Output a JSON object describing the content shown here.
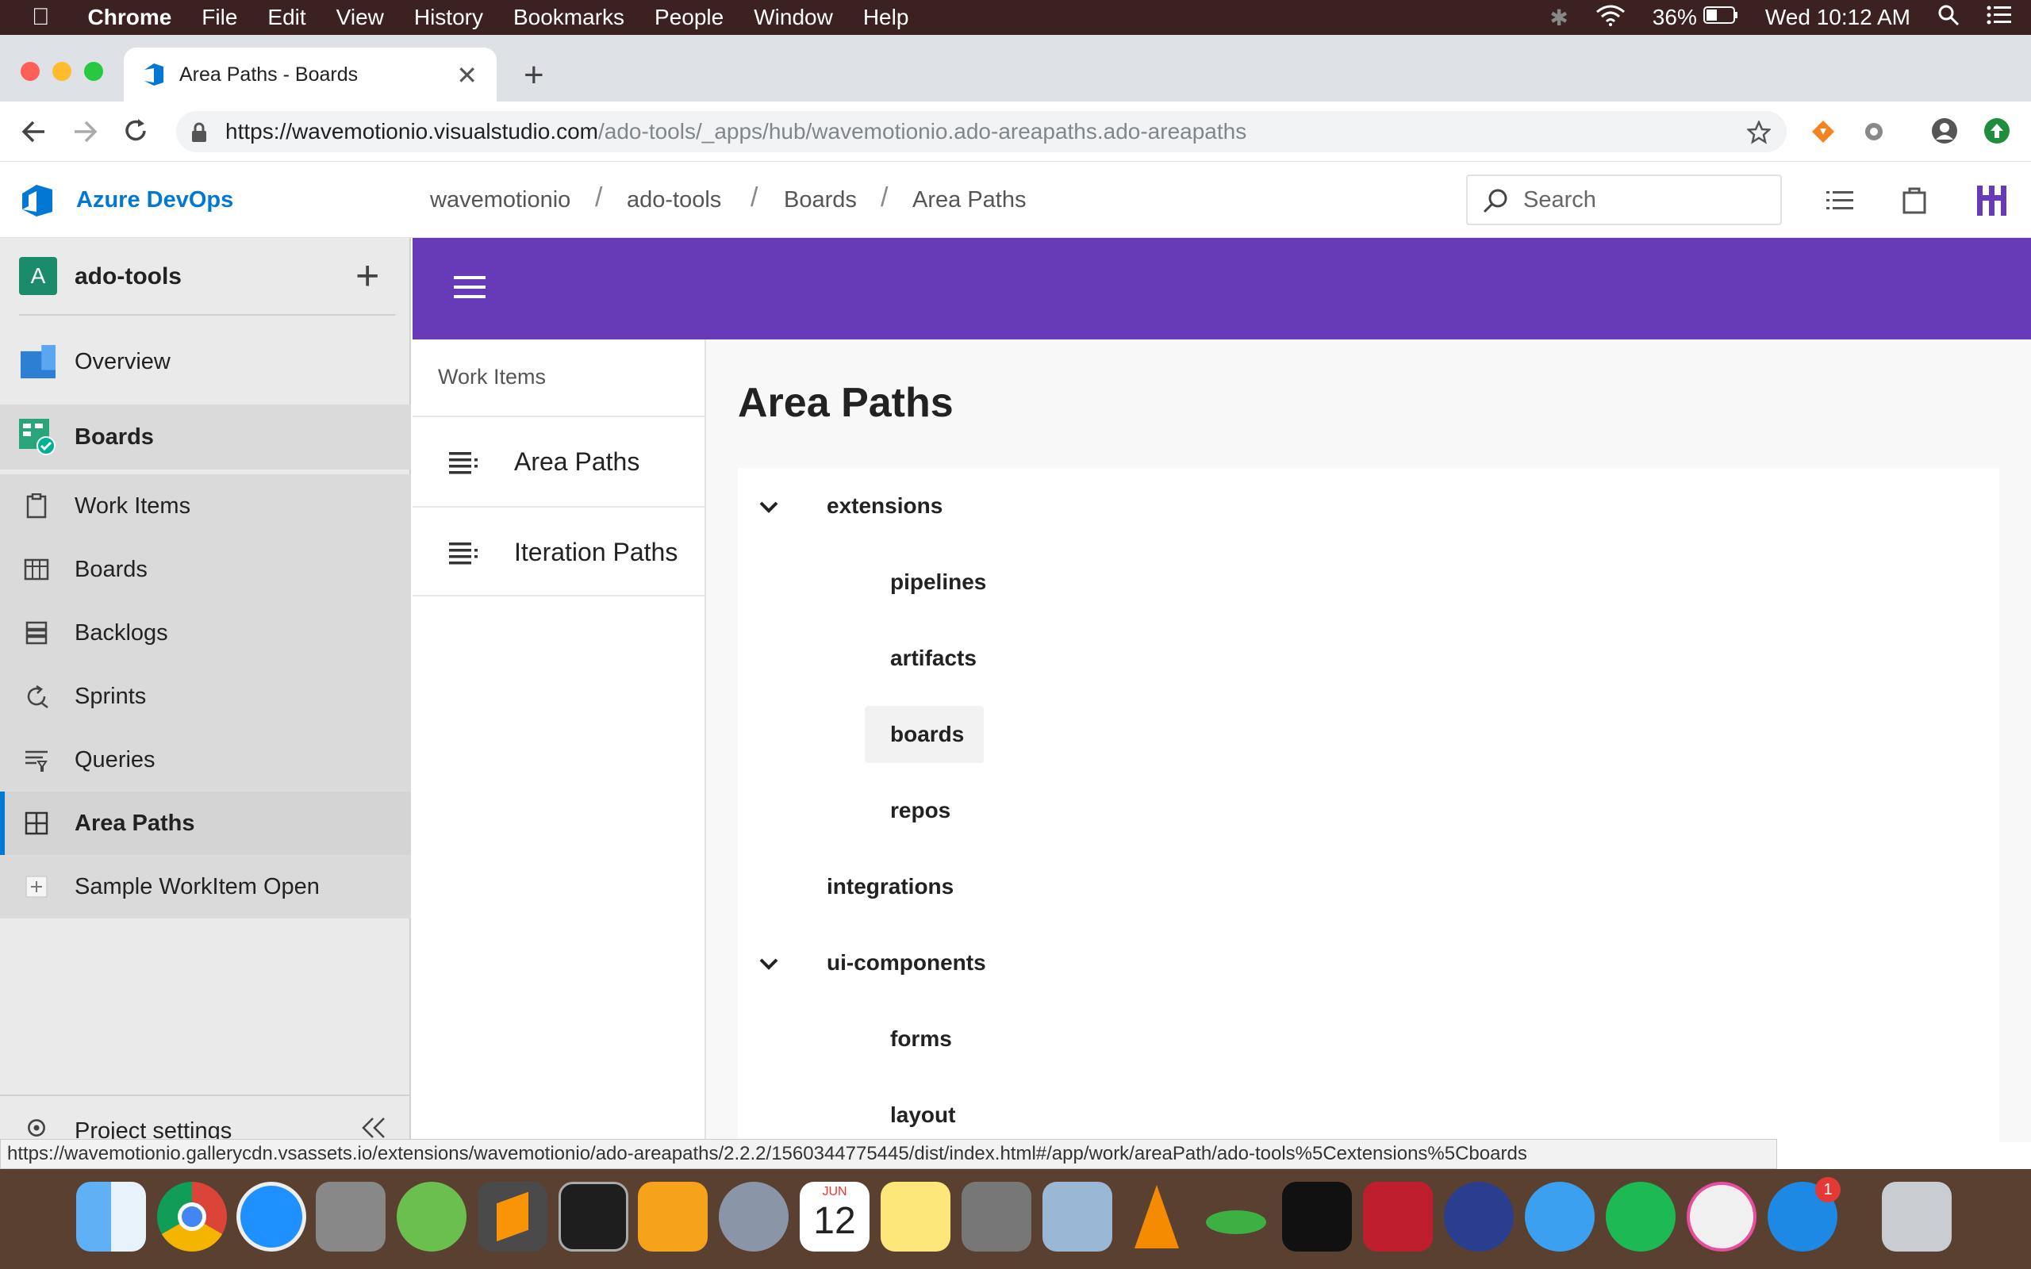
{
  "menubar": {
    "apple": "",
    "app": "Chrome",
    "items": [
      "File",
      "Edit",
      "View",
      "History",
      "Bookmarks",
      "People",
      "Window",
      "Help"
    ],
    "battery": "36%",
    "clock": "Wed 10:12 AM"
  },
  "browser": {
    "tab_title": "Area Paths - Boards",
    "url_host": "https://wavemotionio.visualstudio.com",
    "url_path": "/ado-tools/_apps/hub/wavemotionio.ado-areapaths.ado-areapaths"
  },
  "header": {
    "brand": "Azure DevOps",
    "breadcrumb": [
      "wavemotionio",
      "ado-tools",
      "Boards",
      "Area Paths"
    ],
    "search_placeholder": "Search"
  },
  "leftnav": {
    "project_initial": "A",
    "project_name": "ado-tools",
    "items": [
      {
        "label": "Overview",
        "icon": "overview-icon"
      },
      {
        "label": "Boards",
        "icon": "boards-hub-icon"
      },
      {
        "label": "Work Items",
        "icon": "work-items-icon"
      },
      {
        "label": "Boards",
        "icon": "boards-icon"
      },
      {
        "label": "Backlogs",
        "icon": "backlogs-icon"
      },
      {
        "label": "Sprints",
        "icon": "sprints-icon"
      },
      {
        "label": "Queries",
        "icon": "queries-icon"
      },
      {
        "label": "Area Paths",
        "icon": "area-paths-icon"
      },
      {
        "label": "Sample WorkItem Open",
        "icon": "plus-square-icon"
      }
    ],
    "settings": "Project settings"
  },
  "subnav": {
    "heading": "Work Items",
    "items": [
      {
        "label": "Area Paths",
        "icon": "list-icon"
      },
      {
        "label": "Iteration Paths",
        "icon": "list-icon"
      }
    ]
  },
  "main": {
    "title": "Area Paths",
    "tree": [
      {
        "label": "extensions",
        "expanded": true
      },
      {
        "label": "pipelines"
      },
      {
        "label": "artifacts"
      },
      {
        "label": "boards",
        "selected": true
      },
      {
        "label": "repos"
      },
      {
        "label": "integrations"
      },
      {
        "label": "ui-components",
        "expanded": true
      },
      {
        "label": "forms"
      },
      {
        "label": "layout"
      }
    ]
  },
  "status_url": "https://wavemotionio.gallerycdn.vsassets.io/extensions/wavemotionio/ado-areapaths/2.2.2/1560344775445/dist/index.html#/app/work/areaPath/ado-tools%5Cextensions%5Cboards",
  "dock": {
    "calendar_month": "JUN",
    "calendar_day": "12",
    "appstore_badge": "1"
  },
  "colors": {
    "hub_purple": "#673ab7",
    "accent_blue": "#0078d4",
    "project_green": "#1a8c6c"
  }
}
